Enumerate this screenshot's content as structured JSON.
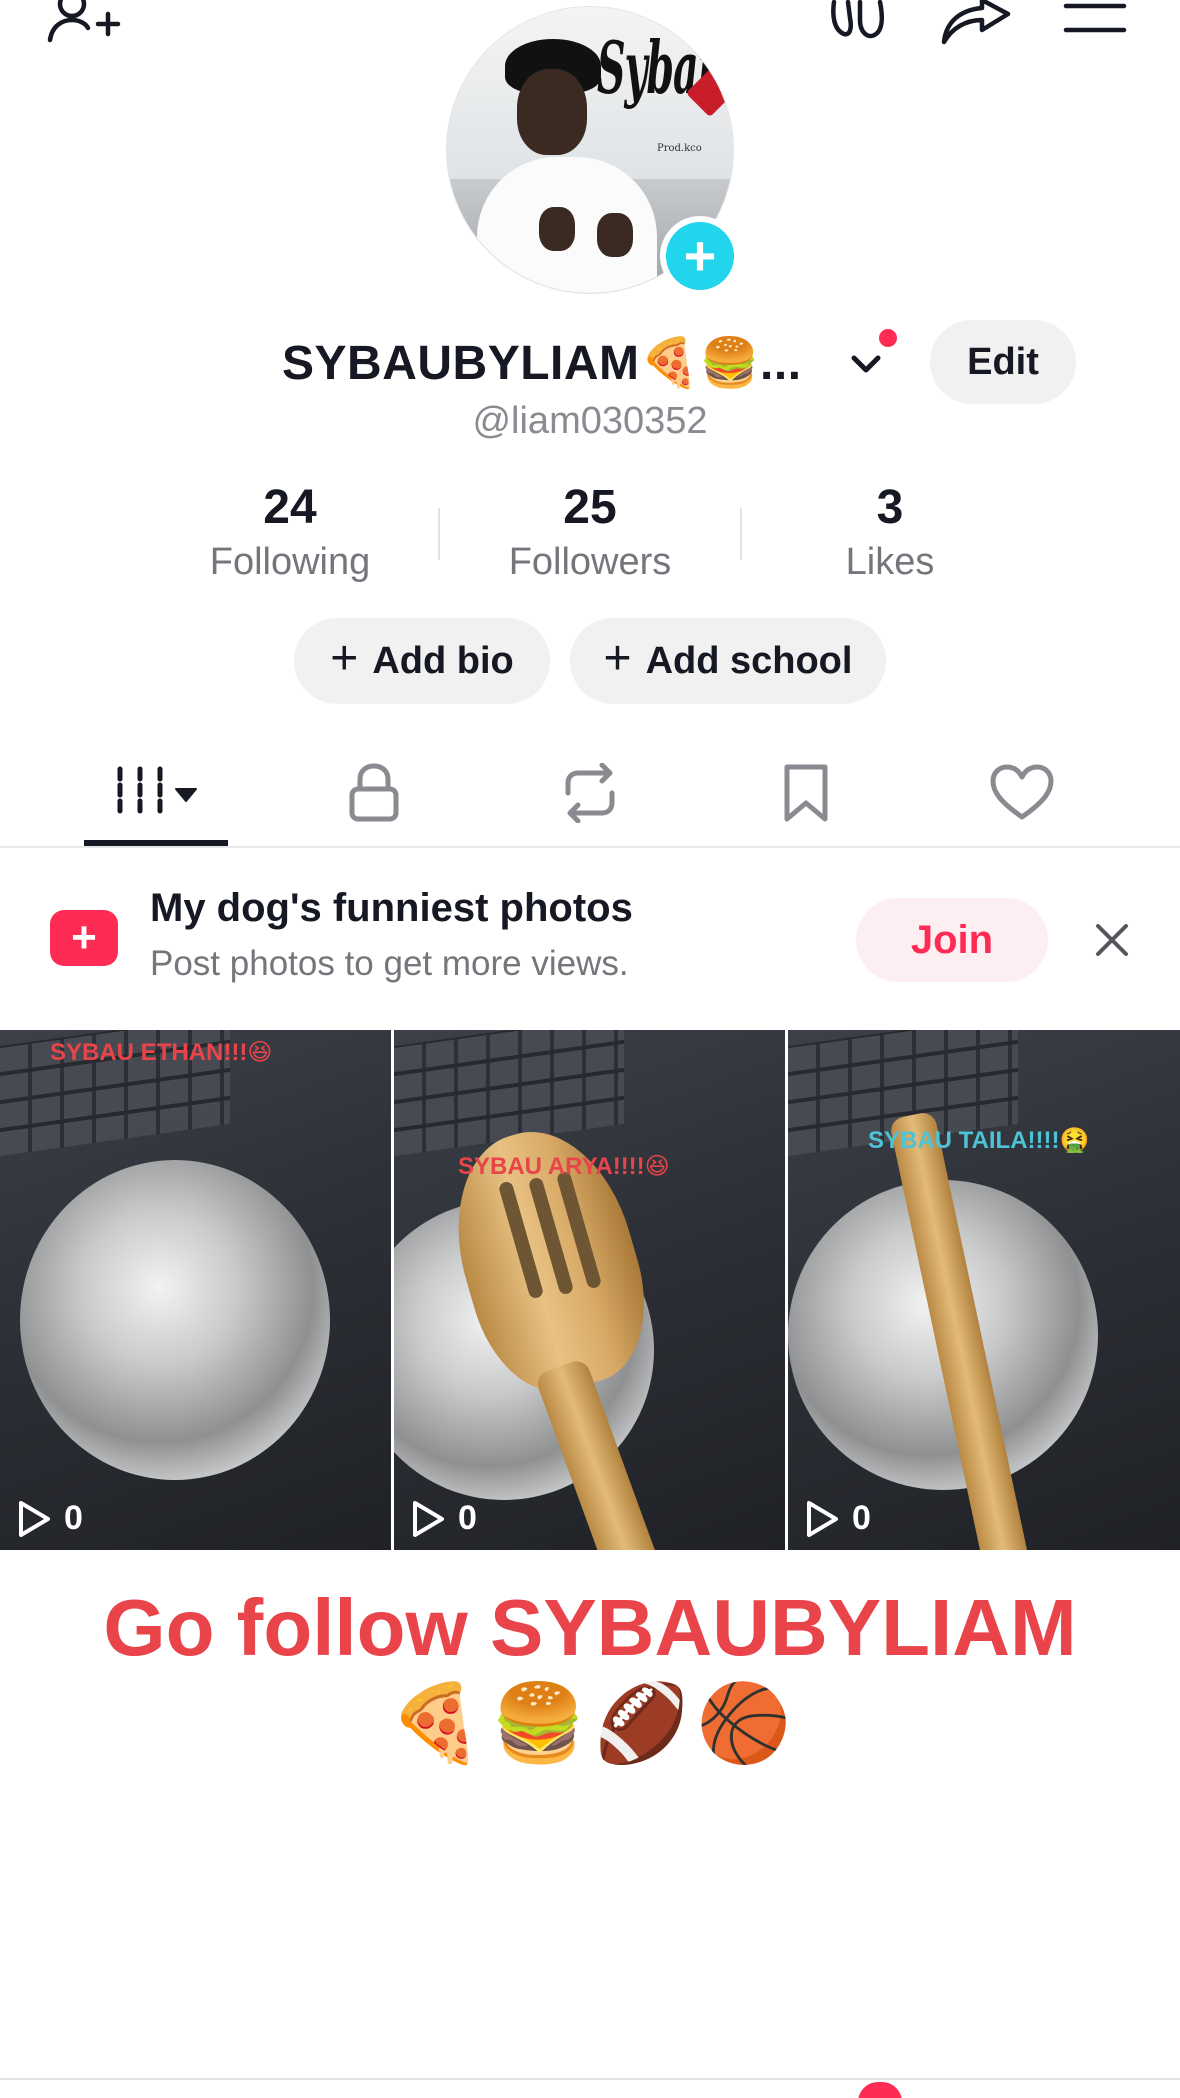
{
  "profile": {
    "display_name": "SYBAUBYLIAM🍕🍔...",
    "handle": "@liam030352",
    "edit_label": "Edit",
    "avatar_text": "Sybau",
    "avatar_subtext": "Prod.kco"
  },
  "stats": [
    {
      "value": "24",
      "label": "Following"
    },
    {
      "value": "25",
      "label": "Followers"
    },
    {
      "value": "3",
      "label": "Likes"
    }
  ],
  "actions": {
    "add_bio": "Add bio",
    "add_school": "Add school"
  },
  "tabs": [
    {
      "icon": "videos-grid-icon",
      "selected": true
    },
    {
      "icon": "lock-icon"
    },
    {
      "icon": "repost-icon"
    },
    {
      "icon": "bookmark-icon"
    },
    {
      "icon": "heart-icon"
    }
  ],
  "promo": {
    "title": "My dog's funniest photos",
    "subtitle": "Post photos to get more views.",
    "join_label": "Join"
  },
  "videos": [
    {
      "caption": "SYBAU ETHAN!!!😆",
      "caption_color": "#e8444a",
      "plays": "0"
    },
    {
      "caption": "SYBAU ARYA!!!!😆",
      "caption_color": "#e8444a",
      "plays": "0"
    },
    {
      "caption": "SYBAU TAILA!!!!🤮",
      "caption_color": "#4ec3d6",
      "plays": "0"
    }
  ],
  "overlay": {
    "headline": "Go follow SYBAUBYLIAM",
    "emojis": [
      "🍕",
      "🍔",
      "🏈",
      "🏀"
    ]
  },
  "colors": {
    "accent": "#fe2c55",
    "verified_plus": "#20d5ec",
    "headline": "#e8444a"
  }
}
